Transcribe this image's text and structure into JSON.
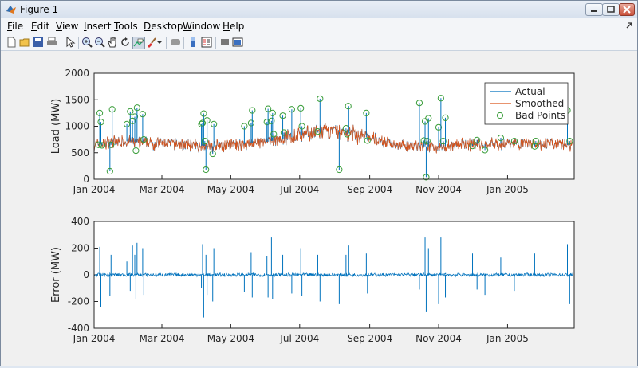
{
  "window": {
    "title": "Figure 1"
  },
  "menu": [
    "File",
    "Edit",
    "View",
    "Insert",
    "Tools",
    "Desktop",
    "Window",
    "Help"
  ],
  "toolbar": {
    "icons": [
      "new-figure-icon",
      "open-file-icon",
      "save-icon",
      "print-icon",
      "edit-plot-arrow-icon",
      "zoom-in-icon",
      "zoom-out-icon",
      "pan-hand-icon",
      "rotate-3d-icon",
      "data-cursor-icon",
      "brush-icon",
      "brush-dropdown-icon",
      "link-plot-icon",
      "insert-colorbar-icon",
      "insert-legend-icon",
      "hide-plot-tools-icon",
      "show-plot-tools-icon"
    ]
  },
  "colors": {
    "actual": "#0072bd",
    "smoothed": "#d95319",
    "bad_points": "#3a9d3a",
    "error": "#0072bd"
  },
  "chart_data": [
    {
      "type": "line",
      "ylabel": "Load (MW)",
      "xlabel": "",
      "xlim": [
        "2004-01-01",
        "2005-03-01"
      ],
      "ylim": [
        0,
        2000
      ],
      "yticks": [
        0,
        500,
        1000,
        1500,
        2000
      ],
      "xticks": [
        "2004-01-01",
        "2004-03-01",
        "2004-05-01",
        "2004-07-01",
        "2004-09-01",
        "2004-11-01",
        "2005-01-01"
      ],
      "xticklabels": [
        "Jan 2004",
        "Mar 2004",
        "May 2004",
        "Jul 2004",
        "Sep 2004",
        "Nov 2004",
        "Jan 2005"
      ],
      "legend_position": "top-right",
      "series": [
        {
          "name": "Actual",
          "kind": "line",
          "x": [
            "2004-01-01",
            "2004-01-15",
            "2004-02-01",
            "2004-02-15",
            "2004-03-01",
            "2004-03-15",
            "2004-04-01",
            "2004-04-15",
            "2004-05-01",
            "2004-05-15",
            "2004-06-01",
            "2004-06-15",
            "2004-07-01",
            "2004-07-15",
            "2004-08-01",
            "2004-08-15",
            "2004-09-01",
            "2004-09-15",
            "2004-10-01",
            "2004-10-15",
            "2004-11-01",
            "2004-11-15",
            "2004-12-01",
            "2004-12-15",
            "2005-01-01",
            "2005-01-15",
            "2005-02-01",
            "2005-02-15",
            "2005-02-28"
          ],
          "y": [
            650,
            700,
            720,
            680,
            680,
            670,
            640,
            620,
            640,
            670,
            700,
            760,
            820,
            880,
            900,
            860,
            780,
            700,
            640,
            620,
            620,
            640,
            660,
            660,
            680,
            680,
            670,
            660,
            640
          ]
        },
        {
          "name": "Smoothed",
          "kind": "line",
          "x": [
            "2004-01-01",
            "2004-01-15",
            "2004-02-01",
            "2004-02-15",
            "2004-03-01",
            "2004-03-15",
            "2004-04-01",
            "2004-04-15",
            "2004-05-01",
            "2004-05-15",
            "2004-06-01",
            "2004-06-15",
            "2004-07-01",
            "2004-07-15",
            "2004-08-01",
            "2004-08-15",
            "2004-09-01",
            "2004-09-15",
            "2004-10-01",
            "2004-10-15",
            "2004-11-01",
            "2004-11-15",
            "2004-12-01",
            "2004-12-15",
            "2005-01-01",
            "2005-01-15",
            "2005-02-01",
            "2005-02-15",
            "2005-02-28"
          ],
          "y": [
            650,
            700,
            720,
            680,
            680,
            670,
            640,
            620,
            640,
            670,
            700,
            760,
            820,
            880,
            900,
            860,
            780,
            700,
            640,
            620,
            620,
            640,
            660,
            660,
            680,
            680,
            670,
            660,
            640
          ]
        },
        {
          "name": "Bad Points",
          "kind": "markers",
          "x": [
            "2004-01-05",
            "2004-01-06",
            "2004-01-07",
            "2004-01-08",
            "2004-01-15",
            "2004-01-16",
            "2004-01-17",
            "2004-01-30",
            "2004-02-02",
            "2004-02-04",
            "2004-02-06",
            "2004-02-07",
            "2004-02-08",
            "2004-02-13",
            "2004-02-14",
            "2004-04-05",
            "2004-04-06",
            "2004-04-07",
            "2004-04-08",
            "2004-04-09",
            "2004-04-10",
            "2004-04-15",
            "2004-04-16",
            "2004-05-13",
            "2004-05-19",
            "2004-05-20",
            "2004-06-02",
            "2004-06-03",
            "2004-06-06",
            "2004-06-07",
            "2004-06-08",
            "2004-06-16",
            "2004-06-17",
            "2004-06-24",
            "2004-07-02",
            "2004-07-03",
            "2004-07-17",
            "2004-07-19",
            "2004-08-05",
            "2004-08-11",
            "2004-08-12",
            "2004-08-13",
            "2004-08-29",
            "2004-08-30",
            "2004-10-15",
            "2004-10-19",
            "2004-10-20",
            "2004-10-21",
            "2004-10-22",
            "2004-10-23",
            "2004-11-01",
            "2004-11-03",
            "2004-11-05",
            "2004-11-07",
            "2004-12-01",
            "2004-12-05",
            "2004-12-12",
            "2004-12-26",
            "2005-01-07",
            "2005-01-25",
            "2005-01-26",
            "2005-02-23",
            "2005-02-25"
          ],
          "y": [
            650,
            1250,
            1080,
            640,
            150,
            650,
            1320,
            1040,
            1280,
            1100,
            1180,
            540,
            1350,
            1230,
            750,
            1040,
            1060,
            1240,
            720,
            180,
            1110,
            480,
            1040,
            1000,
            1060,
            1300,
            1080,
            1330,
            1100,
            1250,
            850,
            1200,
            880,
            1320,
            1340,
            1000,
            900,
            1520,
            180,
            960,
            850,
            1380,
            1250,
            730,
            1440,
            730,
            1090,
            40,
            720,
            1150,
            980,
            1530,
            720,
            1160,
            630,
            740,
            550,
            780,
            720,
            620,
            720,
            1300,
            720
          ]
        }
      ]
    },
    {
      "type": "line",
      "ylabel": "Error (MW)",
      "xlabel": "",
      "xlim": [
        "2004-01-01",
        "2005-03-01"
      ],
      "ylim": [
        -400,
        400
      ],
      "yticks": [
        -400,
        -200,
        0,
        200,
        400
      ],
      "xticks": [
        "2004-01-01",
        "2004-03-01",
        "2004-05-01",
        "2004-07-01",
        "2004-09-01",
        "2004-11-01",
        "2005-01-01"
      ],
      "xticklabels": [
        "Jan 2004",
        "Mar 2004",
        "May 2004",
        "Jul 2004",
        "Sep 2004",
        "Nov 2004",
        "Jan 2005"
      ],
      "series": [
        {
          "kind": "spikes",
          "x": [
            "2004-01-06",
            "2004-01-07",
            "2004-01-15",
            "2004-01-16",
            "2004-01-30",
            "2004-02-02",
            "2004-02-04",
            "2004-02-06",
            "2004-02-07",
            "2004-02-08",
            "2004-02-13",
            "2004-02-14",
            "2004-04-05",
            "2004-04-06",
            "2004-04-07",
            "2004-04-09",
            "2004-04-10",
            "2004-04-15",
            "2004-04-16",
            "2004-05-13",
            "2004-05-19",
            "2004-05-20",
            "2004-06-02",
            "2004-06-03",
            "2004-06-06",
            "2004-06-07",
            "2004-06-16",
            "2004-06-24",
            "2004-07-02",
            "2004-07-03",
            "2004-07-17",
            "2004-07-19",
            "2004-08-05",
            "2004-08-11",
            "2004-08-13",
            "2004-08-29",
            "2004-08-30",
            "2004-10-15",
            "2004-10-20",
            "2004-10-21",
            "2004-10-23",
            "2004-11-01",
            "2004-11-03",
            "2004-11-07",
            "2004-12-01",
            "2004-12-05",
            "2004-12-12",
            "2004-12-26",
            "2005-01-07",
            "2005-01-25",
            "2005-02-23",
            "2005-02-25"
          ],
          "y": [
            210,
            -240,
            -160,
            150,
            100,
            -120,
            220,
            150,
            -180,
            240,
            200,
            -150,
            -100,
            230,
            -320,
            150,
            -150,
            -200,
            200,
            -130,
            170,
            -170,
            140,
            -170,
            280,
            -180,
            150,
            -140,
            200,
            -160,
            150,
            -200,
            -220,
            150,
            220,
            160,
            -140,
            -110,
            280,
            -280,
            200,
            -220,
            280,
            -170,
            160,
            -110,
            -150,
            130,
            -120,
            160,
            230,
            -220
          ]
        }
      ]
    }
  ]
}
